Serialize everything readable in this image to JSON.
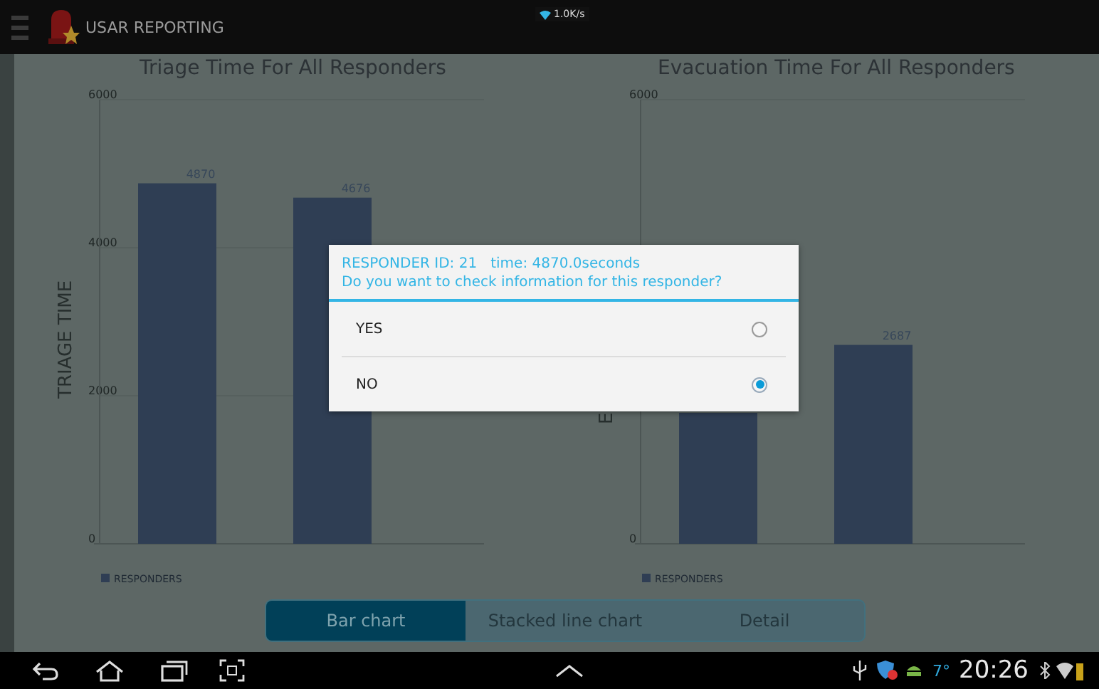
{
  "app_bar": {
    "title": "USAR REPORTING",
    "network_speed": "1.0K/s"
  },
  "charts": [
    {
      "chart_data": {
        "type": "bar",
        "title": "Triage Time For All Responders",
        "ylabel": "TRIAGE TIME",
        "series": [
          {
            "name": "RESPONDERS",
            "color": "#2f3e54",
            "values": [
              4870,
              4676
            ]
          }
        ],
        "ylim": [
          0,
          6000
        ],
        "yticks": [
          0,
          2000,
          4000,
          6000
        ],
        "data_labels": true
      }
    },
    {
      "chart_data": {
        "type": "bar",
        "title": "Evacuation Time For All Responders",
        "ylabel": "E",
        "series": [
          {
            "name": "RESPONDERS",
            "color": "#2f3e54",
            "values": [
              null,
              2687
            ]
          }
        ],
        "ylim": [
          0,
          6000
        ],
        "yticks": [
          0,
          6000
        ],
        "data_labels": true
      }
    }
  ],
  "dialog": {
    "title_lines": [
      "RESPONDER ID: 21   time: 4870.0seconds",
      "Do you want to check information for this responder?"
    ],
    "options": [
      {
        "label": "YES",
        "selected": false
      },
      {
        "label": "NO",
        "selected": true
      }
    ]
  },
  "tabs": [
    {
      "label": "Bar chart",
      "selected": true
    },
    {
      "label": "Stacked line chart",
      "selected": false
    },
    {
      "label": "Detail",
      "selected": false
    }
  ],
  "status_bar": {
    "temperature": "7°",
    "time": "20:26"
  }
}
